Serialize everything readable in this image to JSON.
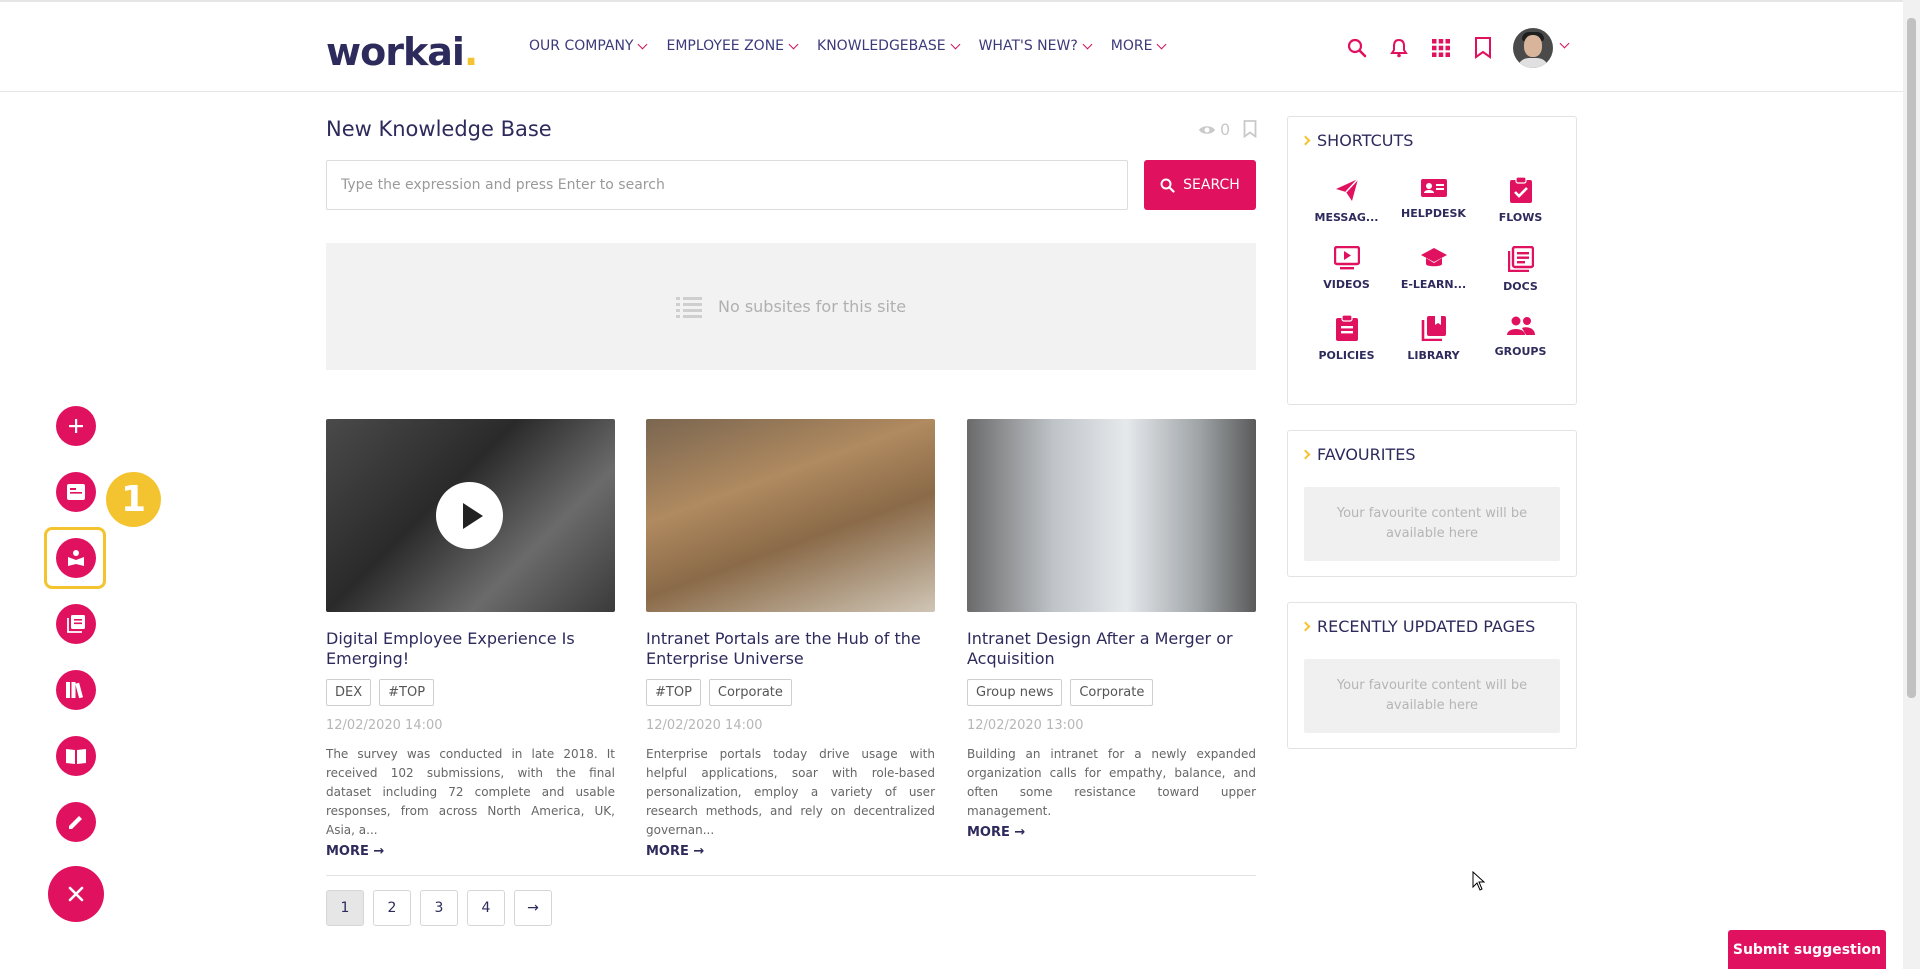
{
  "header": {
    "logo_text": "workai",
    "logo_dot": ".",
    "nav": [
      {
        "label": "OUR COMPANY"
      },
      {
        "label": "EMPLOYEE ZONE"
      },
      {
        "label": "KNOWLEDGEBASE"
      },
      {
        "label": "WHAT'S NEW?"
      },
      {
        "label": "MORE"
      }
    ]
  },
  "main": {
    "title": "New Knowledge Base",
    "views_count": "0",
    "search": {
      "placeholder": "Type the expression and press Enter to search",
      "button_label": "SEARCH"
    },
    "subsites_empty": "No subsites for this site",
    "cards": [
      {
        "title": "Digital Employee Experience Is Emerging!",
        "tags": [
          "DEX",
          "#TOP"
        ],
        "date": "12/02/2020 14:00",
        "text": "The survey was conducted in late 2018. It received 102 submissions, with the final dataset including 72 complete and usable responses, from across North America, UK, Asia, a...",
        "more": "MORE →",
        "has_video": true
      },
      {
        "title": "Intranet Portals are the Hub of the Enterprise Universe",
        "tags": [
          "#TOP",
          "Corporate"
        ],
        "date": "12/02/2020 14:00",
        "text": "Enterprise portals today drive usage with helpful applications, soar with role-based personalization, employ a variety of user research methods, and rely on decentralized governan...",
        "more": "MORE →",
        "has_video": false
      },
      {
        "title": "Intranet Design After a Merger or Acquisition",
        "tags": [
          "Group news",
          "Corporate"
        ],
        "date": "12/02/2020 13:00",
        "text": "Building an intranet for a newly expanded organization calls for empathy, balance, and often some resistance toward upper management.",
        "more": "MORE →",
        "has_video": false
      }
    ],
    "pagination": [
      "1",
      "2",
      "3",
      "4",
      "→"
    ],
    "current_page": "1"
  },
  "sidebar": {
    "shortcuts_title": "SHORTCUTS",
    "shortcuts": [
      {
        "label": "MESSAG...",
        "icon": "paper-plane-icon"
      },
      {
        "label": "HELPDESK",
        "icon": "contact-card-icon"
      },
      {
        "label": "FLOWS",
        "icon": "clipboard-check-icon"
      },
      {
        "label": "VIDEOS",
        "icon": "video-icon"
      },
      {
        "label": "E-LEARN...",
        "icon": "graduation-cap-icon"
      },
      {
        "label": "DOCS",
        "icon": "documents-icon"
      },
      {
        "label": "POLICIES",
        "icon": "clipboard-list-icon"
      },
      {
        "label": "LIBRARY",
        "icon": "library-icon"
      },
      {
        "label": "GROUPS",
        "icon": "groups-icon"
      }
    ],
    "favourites_title": "FAVOURITES",
    "favourites_empty": "Your favourite content will be available here",
    "recent_title": "RECENTLY UPDATED PAGES",
    "recent_empty": "Your favourite content will be available here"
  },
  "fab": {
    "step_badge": "1"
  },
  "submit_suggestion": "Submit suggestion",
  "colors": {
    "accent": "#e0115f",
    "brand_dark": "#2d2a5c",
    "highlight": "#f4c430"
  }
}
